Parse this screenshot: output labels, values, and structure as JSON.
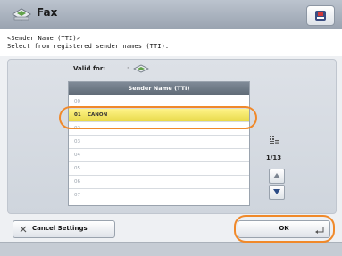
{
  "header": {
    "title": "Fax",
    "fax_icon": "fax-machine-icon",
    "status_icon": "status-monitor-icon"
  },
  "instruction": {
    "line1": "<Sender Name (TTI)>",
    "line2": "Select from registered sender names (TTI)."
  },
  "valid_for": {
    "label": "Valid for:",
    "value": ":",
    "icon": "fax-machine-icon"
  },
  "list": {
    "header": "Sender Name (TTI)",
    "rows": [
      {
        "num": "00",
        "name": ""
      },
      {
        "num": "01",
        "name": "CANON",
        "selected": true
      },
      {
        "num": "02",
        "name": ""
      },
      {
        "num": "03",
        "name": ""
      },
      {
        "num": "04",
        "name": ""
      },
      {
        "num": "05",
        "name": ""
      },
      {
        "num": "06",
        "name": ""
      },
      {
        "num": "07",
        "name": ""
      }
    ]
  },
  "pagination": {
    "page": "1/13"
  },
  "buttons": {
    "cancel": "Cancel Settings",
    "ok": "OK"
  },
  "colors": {
    "highlight": "#f0892a",
    "selected_row": "#fff48a",
    "list_header": "#6b7683"
  }
}
